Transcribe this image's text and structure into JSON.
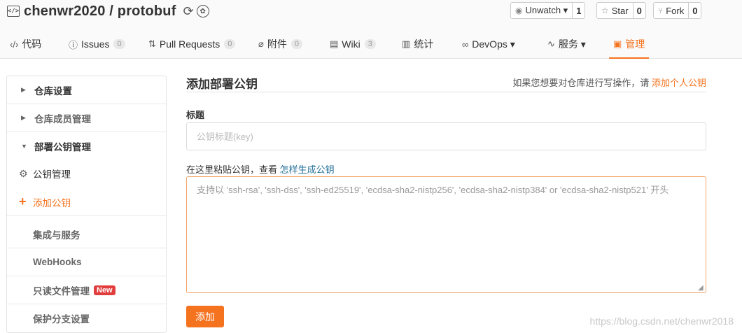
{
  "repo": {
    "name": "chenwr2020 / protobuf",
    "icon": "repo-code-icon",
    "sync_icon": "sync-icon",
    "badge_icon": "certified-icon"
  },
  "actions": {
    "watch": {
      "label": "Unwatch ▾",
      "count": "1",
      "icon": "eye-icon"
    },
    "star": {
      "label": "Star",
      "count": "0",
      "icon": "star-icon"
    },
    "fork": {
      "label": "Fork",
      "count": "0",
      "icon": "fork-icon"
    }
  },
  "tabs": [
    {
      "label": "代码",
      "icon": "code-icon",
      "count": ""
    },
    {
      "label": "Issues",
      "icon": "issue-icon",
      "count": "0"
    },
    {
      "label": "Pull Requests",
      "icon": "pull-request-icon",
      "count": "0"
    },
    {
      "label": "附件",
      "icon": "paperclip-icon",
      "count": "0"
    },
    {
      "label": "Wiki",
      "icon": "wiki-icon",
      "count": "3"
    },
    {
      "label": "统计",
      "icon": "stats-icon",
      "count": ""
    },
    {
      "label": "DevOps ▾",
      "icon": "infinity-icon",
      "count": ""
    },
    {
      "label": "服务 ▾",
      "icon": "pulse-icon",
      "count": ""
    },
    {
      "label": "管理",
      "icon": "admin-icon",
      "count": "",
      "active": true
    }
  ],
  "sidebar": {
    "items": [
      {
        "label": "仓库设置"
      },
      {
        "label": "仓库成员管理"
      },
      {
        "label": "部署公钥管理"
      },
      {
        "label": "公钥管理"
      },
      {
        "label": "添加公钥"
      },
      {
        "label": "集成与服务"
      },
      {
        "label": "WebHooks"
      },
      {
        "label": "只读文件管理",
        "badge": "New"
      },
      {
        "label": "保护分支设置"
      }
    ]
  },
  "main": {
    "title": "添加部署公钥",
    "hint_prefix": "如果您想要对仓库进行写操作，请",
    "hint_link": "添加个人公钥",
    "title_label": "标题",
    "title_placeholder": "公钥标题(key)",
    "key_hint_prefix": "在这里粘贴公钥，查看",
    "key_hint_link": "怎样生成公钥",
    "key_placeholder": "支持以 'ssh-rsa', 'ssh-dss', 'ssh-ed25519', 'ecdsa-sha2-nistp256', 'ecdsa-sha2-nistp384' or 'ecdsa-sha2-nistp521' 开头",
    "submit_label": "添加"
  },
  "watermark": "https://blog.csdn.net/chenwr2018",
  "colors": {
    "accent": "#f5721e",
    "link": "#1f6d96",
    "badge": "#e23d3d"
  }
}
